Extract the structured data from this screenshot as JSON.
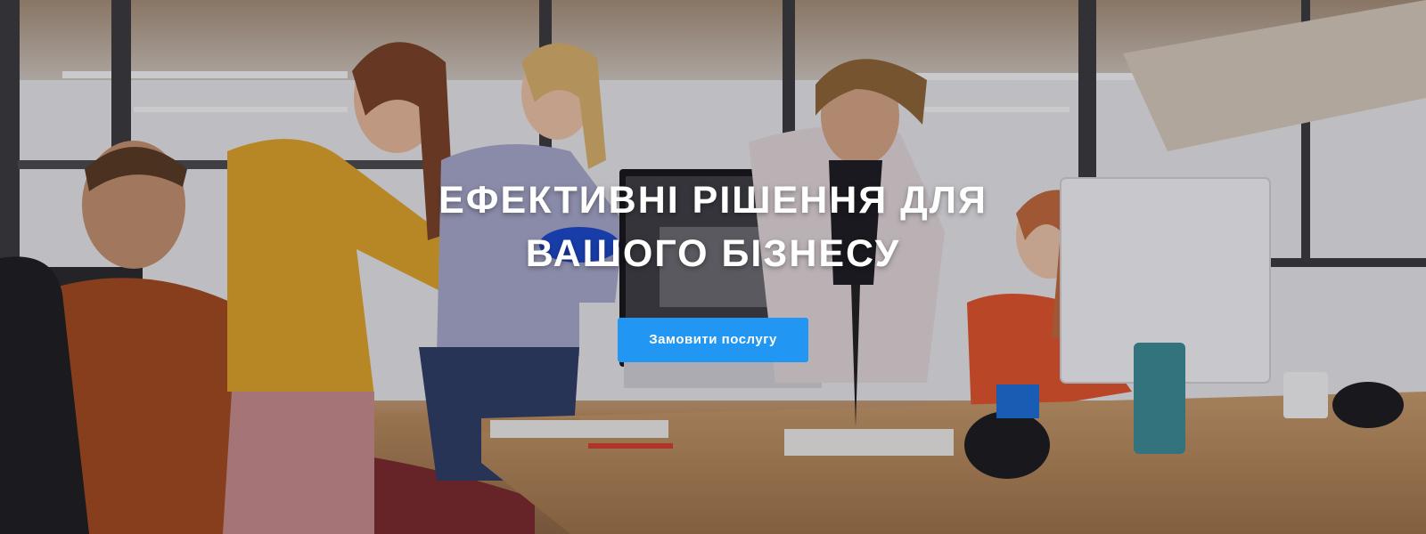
{
  "hero": {
    "title_line_1": "ЕФЕКТИВНІ РІШЕННЯ ДЛЯ",
    "title_line_2": "ВАШОГО БІЗНЕСУ",
    "cta_label": "Замовити послугу"
  },
  "colors": {
    "accent": "#2196f3",
    "title_text": "#ffffff"
  }
}
